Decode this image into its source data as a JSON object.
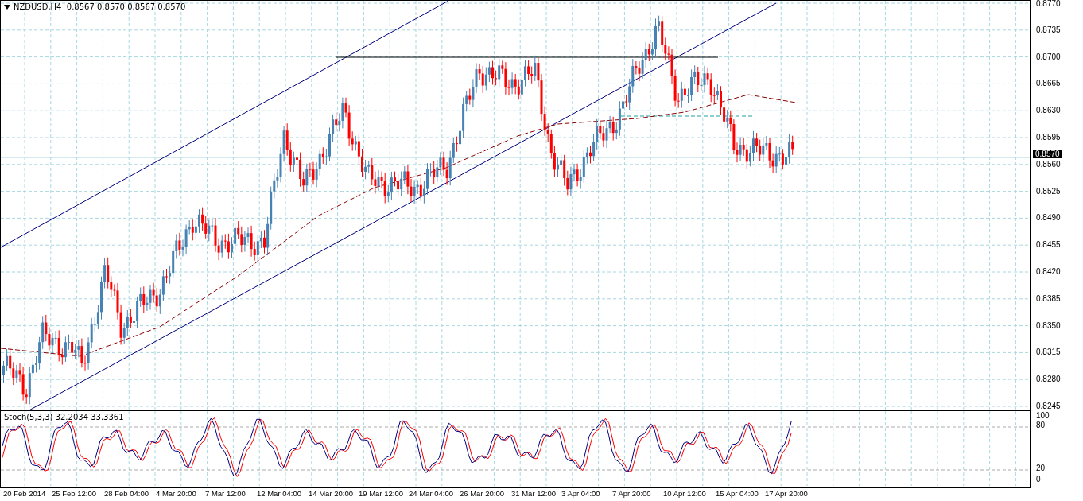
{
  "chart": {
    "symbol_header": "NZDUSD,H4  0.8567 0.8570 0.8567 0.8570",
    "current_price": "0.8570",
    "price_labels": [
      "0.8770",
      "0.8735",
      "0.8700",
      "0.8665",
      "0.8630",
      "0.8595",
      "0.8560",
      "0.8525",
      "0.8490",
      "0.8455",
      "0.8420",
      "0.8385",
      "0.8350",
      "0.8315",
      "0.8280",
      "0.8245"
    ]
  },
  "indicator": {
    "label": "Stoch(5,3,3) 32.2034 33.3361",
    "levels": [
      "100",
      "80",
      "20",
      "0"
    ]
  },
  "time_labels": [
    "20 Feb 2014",
    "25 Feb 12:00",
    "28 Feb 04:00",
    "4 Mar 20:00",
    "7 Mar 12:00",
    "12 Mar 04:00",
    "14 Mar 20:00",
    "19 Mar 12:00",
    "24 Mar 04:00",
    "26 Mar 20:00",
    "31 Mar 12:00",
    "3 Apr 04:00",
    "7 Apr 20:00",
    "10 Apr 12:00",
    "15 Apr 04:00",
    "17 Apr 20:00"
  ]
}
